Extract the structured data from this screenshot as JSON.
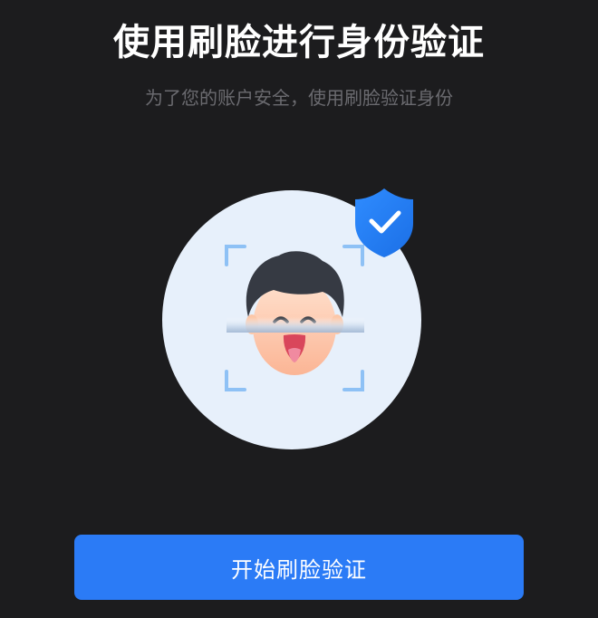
{
  "header": {
    "title": "使用刷脸进行身份验证",
    "subtitle": "为了您的账户安全，使用刷脸验证身份"
  },
  "illustration": {
    "face_icon": "face-avatar-icon",
    "badge_icon": "shield-check-icon",
    "scan_frame_icon": "scan-corners-icon"
  },
  "actions": {
    "start_label": "开始刷脸验证"
  },
  "colors": {
    "background": "#1c1c1e",
    "accent": "#2b7bf6",
    "circle": "#e7f0fb"
  }
}
